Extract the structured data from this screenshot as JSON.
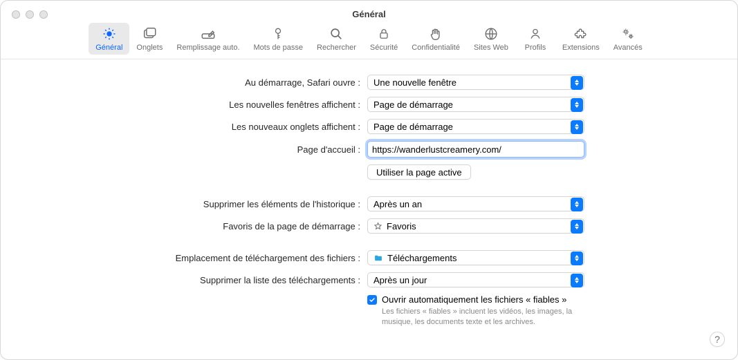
{
  "title": "Général",
  "toolbar": [
    {
      "id": "general",
      "label": "Général",
      "selected": true
    },
    {
      "id": "tabs",
      "label": "Onglets",
      "selected": false
    },
    {
      "id": "autofill",
      "label": "Remplissage auto.",
      "selected": false
    },
    {
      "id": "passwords",
      "label": "Mots de passe",
      "selected": false
    },
    {
      "id": "search",
      "label": "Rechercher",
      "selected": false
    },
    {
      "id": "security",
      "label": "Sécurité",
      "selected": false
    },
    {
      "id": "privacy",
      "label": "Confidentialité",
      "selected": false
    },
    {
      "id": "websites",
      "label": "Sites Web",
      "selected": false
    },
    {
      "id": "profiles",
      "label": "Profils",
      "selected": false
    },
    {
      "id": "extensions",
      "label": "Extensions",
      "selected": false
    },
    {
      "id": "advanced",
      "label": "Avancés",
      "selected": false
    }
  ],
  "form": {
    "startup_label": "Au démarrage, Safari ouvre :",
    "startup_value": "Une nouvelle fenêtre",
    "new_windows_label": "Les nouvelles fenêtres affichent :",
    "new_windows_value": "Page de démarrage",
    "new_tabs_label": "Les nouveaux onglets affichent :",
    "new_tabs_value": "Page de démarrage",
    "homepage_label": "Page d'accueil :",
    "homepage_value": "https://wanderlustcreamery.com/",
    "use_current_btn": "Utiliser la page active",
    "history_label": "Supprimer les éléments de l'historique :",
    "history_value": "Après un an",
    "favs_label": "Favoris de la page de démarrage :",
    "favs_value": "Favoris",
    "dl_loc_label": "Emplacement de téléchargement des fichiers :",
    "dl_loc_value": "Téléchargements",
    "dl_clear_label": "Supprimer la liste des téléchargements :",
    "dl_clear_value": "Après un jour",
    "open_safe_label": "Ouvrir automatiquement les fichiers « fiables »",
    "open_safe_hint": "Les fichiers « fiables » incluent les vidéos, les images, la musique, les documents texte et les archives.",
    "open_safe_checked": true
  },
  "help": "?"
}
